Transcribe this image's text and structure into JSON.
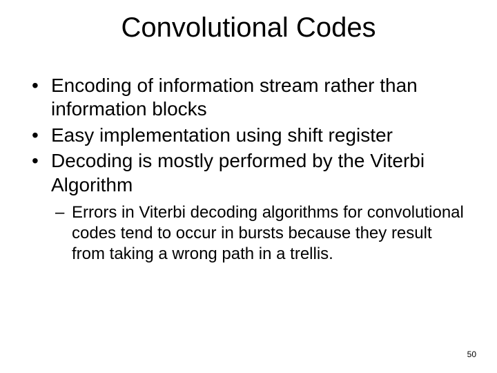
{
  "slide": {
    "title": "Convolutional Codes",
    "bullets": [
      "Encoding of information stream rather than information blocks",
      "Easy implementation using shift register",
      "Decoding is mostly performed by the Viterbi Algorithm"
    ],
    "sub_bullets": [
      "Errors in Viterbi decoding algorithms for convolutional codes tend to occur in bursts because they result from taking a wrong path in a trellis."
    ],
    "page_number": "50"
  }
}
